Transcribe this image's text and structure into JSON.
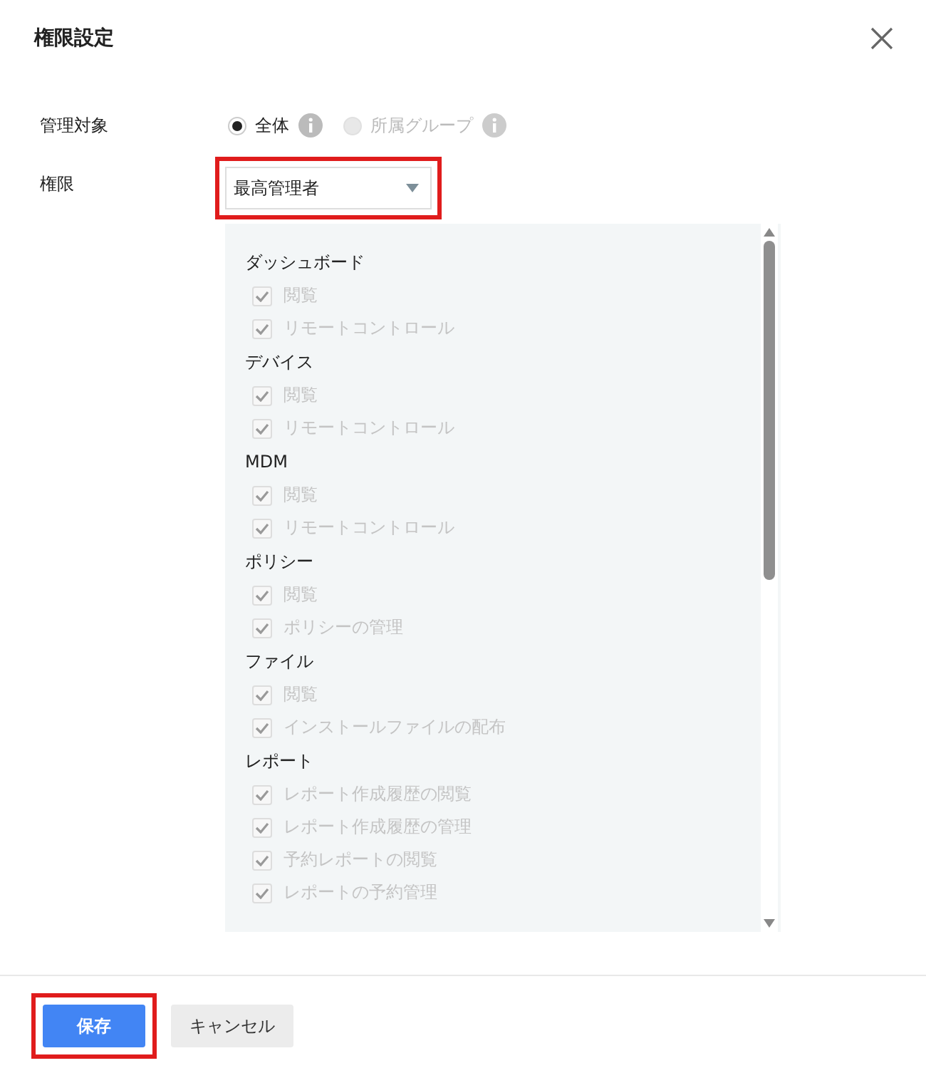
{
  "dialog": {
    "title": "権限設定"
  },
  "scope": {
    "label": "管理対象",
    "options": [
      {
        "label": "全体",
        "selected": true,
        "disabled": false
      },
      {
        "label": "所属グループ",
        "selected": false,
        "disabled": true
      }
    ]
  },
  "role": {
    "label": "権限",
    "value": "最高管理者",
    "highlighted": true
  },
  "permissions": [
    {
      "group": "ダッシュボード",
      "items": [
        {
          "label": "閲覧",
          "checked": true,
          "disabled": true
        },
        {
          "label": "リモートコントロール",
          "checked": true,
          "disabled": true
        }
      ]
    },
    {
      "group": "デバイス",
      "items": [
        {
          "label": "閲覧",
          "checked": true,
          "disabled": true
        },
        {
          "label": "リモートコントロール",
          "checked": true,
          "disabled": true
        }
      ]
    },
    {
      "group": "MDM",
      "items": [
        {
          "label": "閲覧",
          "checked": true,
          "disabled": true
        },
        {
          "label": "リモートコントロール",
          "checked": true,
          "disabled": true
        }
      ]
    },
    {
      "group": "ポリシー",
      "items": [
        {
          "label": "閲覧",
          "checked": true,
          "disabled": true
        },
        {
          "label": "ポリシーの管理",
          "checked": true,
          "disabled": true
        }
      ]
    },
    {
      "group": "ファイル",
      "items": [
        {
          "label": "閲覧",
          "checked": true,
          "disabled": true
        },
        {
          "label": "インストールファイルの配布",
          "checked": true,
          "disabled": true
        }
      ]
    },
    {
      "group": "レポート",
      "items": [
        {
          "label": "レポート作成履歴の閲覧",
          "checked": true,
          "disabled": true
        },
        {
          "label": "レポート作成履歴の管理",
          "checked": true,
          "disabled": true
        },
        {
          "label": "予約レポートの閲覧",
          "checked": true,
          "disabled": true
        },
        {
          "label": "レポートの予約管理",
          "checked": true,
          "disabled": true
        }
      ]
    }
  ],
  "buttons": [
    {
      "label": "保存",
      "kind": "primary",
      "highlighted": true
    },
    {
      "label": "キャンセル",
      "kind": "secondary",
      "highlighted": false
    }
  ]
}
